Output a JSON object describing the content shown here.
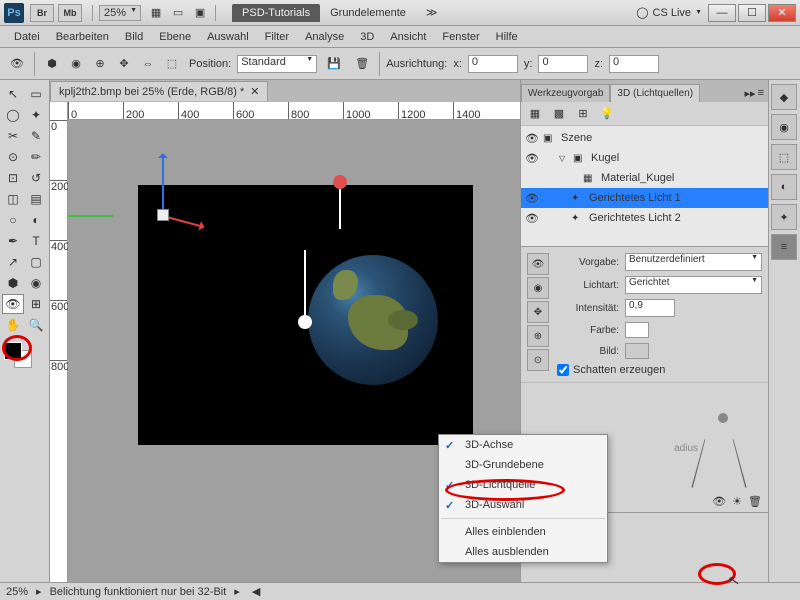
{
  "titlebar": {
    "br": "Br",
    "mb": "Mb",
    "zoom": "25%",
    "tab_psd": "PSD-Tutorials",
    "tab_name": "Grundelemente",
    "chev": "≫",
    "cslive": "CS Live"
  },
  "menu": [
    "Datei",
    "Bearbeiten",
    "Bild",
    "Ebene",
    "Auswahl",
    "Filter",
    "Analyse",
    "3D",
    "Ansicht",
    "Fenster",
    "Hilfe"
  ],
  "optbar": {
    "position": "Position:",
    "pos_preset": "Standard",
    "ausrichtung": "Ausrichtung:",
    "x": "x:",
    "xval": "0",
    "y": "y:",
    "yval": "0",
    "z": "z:",
    "zval": "0"
  },
  "doctab": "kplj2th2.bmp bei 25% (Erde, RGB/8) *",
  "ruler_h": [
    "0",
    "200",
    "400",
    "600",
    "800",
    "1000",
    "1200",
    "1400"
  ],
  "ruler_v": [
    "0",
    "200",
    "400",
    "600",
    "800"
  ],
  "panel3d": {
    "tab1": "Werkzeugvorgab",
    "tab2": "3D (Lichtquellen)"
  },
  "tree": {
    "szene": "Szene",
    "kugel": "Kugel",
    "material": "Material_Kugel",
    "licht1": "Gerichtetes Licht 1",
    "licht2": "Gerichtetes Licht 2"
  },
  "props": {
    "vorgabe": "Vorgabe:",
    "vorgabe_val": "Benutzerdefiniert",
    "lichtart": "Lichtart:",
    "lichtart_val": "Gerichtet",
    "intensitaet": "Intensität:",
    "intensitaet_val": "0,9",
    "farbe": "Farbe:",
    "bild": "Bild:",
    "schatten": "Schatten erzeugen",
    "radius": "adius"
  },
  "context": {
    "achse": "3D-Achse",
    "grundebene": "3D-Grundebene",
    "lichtquelle": "3D-Lichtquelle",
    "auswahl": "3D-Auswahl",
    "einblenden": "Alles einblenden",
    "ausblenden": "Alles ausblenden"
  },
  "status": {
    "zoom": "25%",
    "msg": "Belichtung funktioniert nur bei 32-Bit"
  }
}
